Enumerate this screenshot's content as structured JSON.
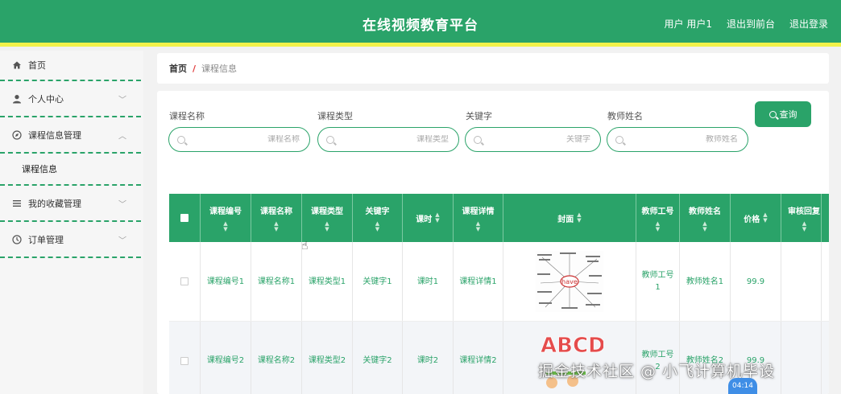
{
  "header": {
    "title": "在线视频教育平台",
    "user": "用户 用户1",
    "to_front": "退出到前台",
    "logout": "退出登录"
  },
  "sidebar": {
    "items": [
      {
        "label": "首页",
        "icon": "home-icon"
      },
      {
        "label": "个人中心",
        "icon": "user-icon"
      },
      {
        "label": "课程信息管理",
        "icon": "compass-icon"
      },
      {
        "label": "课程信息",
        "sub": true
      },
      {
        "label": "我的收藏管理",
        "icon": "list-icon"
      },
      {
        "label": "订单管理",
        "icon": "clock-icon"
      }
    ]
  },
  "breadcrumb": {
    "home": "首页",
    "sep": "/",
    "current": "课程信息"
  },
  "search": {
    "fields": [
      {
        "label": "课程名称",
        "placeholder": "课程名称"
      },
      {
        "label": "课程类型",
        "placeholder": "课程类型"
      },
      {
        "label": "关键字",
        "placeholder": "关键字"
      },
      {
        "label": "教师姓名",
        "placeholder": "教师姓名"
      }
    ],
    "button": "查询"
  },
  "table": {
    "columns": [
      "课程编号",
      "课程名称",
      "课程类型",
      "关键字",
      "课时",
      "课程详情",
      "封面",
      "教师工号",
      "教师姓名",
      "价格",
      "审核回复"
    ],
    "rows": [
      {
        "c1": "课程编号1",
        "c2": "课程名称1",
        "c3": "课程类型1",
        "c4": "关键字1",
        "c5": "课时1",
        "c6": "课程详情1",
        "c8": "教师工号1",
        "c9": "教师姓名1",
        "c10": "99.9",
        "cover_text": "have"
      },
      {
        "c1": "课程编号2",
        "c2": "课程名称2",
        "c3": "课程类型2",
        "c4": "关键字2",
        "c5": "课时2",
        "c6": "课程详情2",
        "c8": "教师工号2",
        "c9": "教师姓名2",
        "c10": "99.9",
        "cover_text": "ABCD"
      }
    ]
  },
  "overlay": {
    "watermark": "掘金技术社区 @ 小飞计算机毕设",
    "time": "04:14"
  },
  "colors": {
    "primary": "#2aa369",
    "accent_bar": "#f2f24a"
  }
}
